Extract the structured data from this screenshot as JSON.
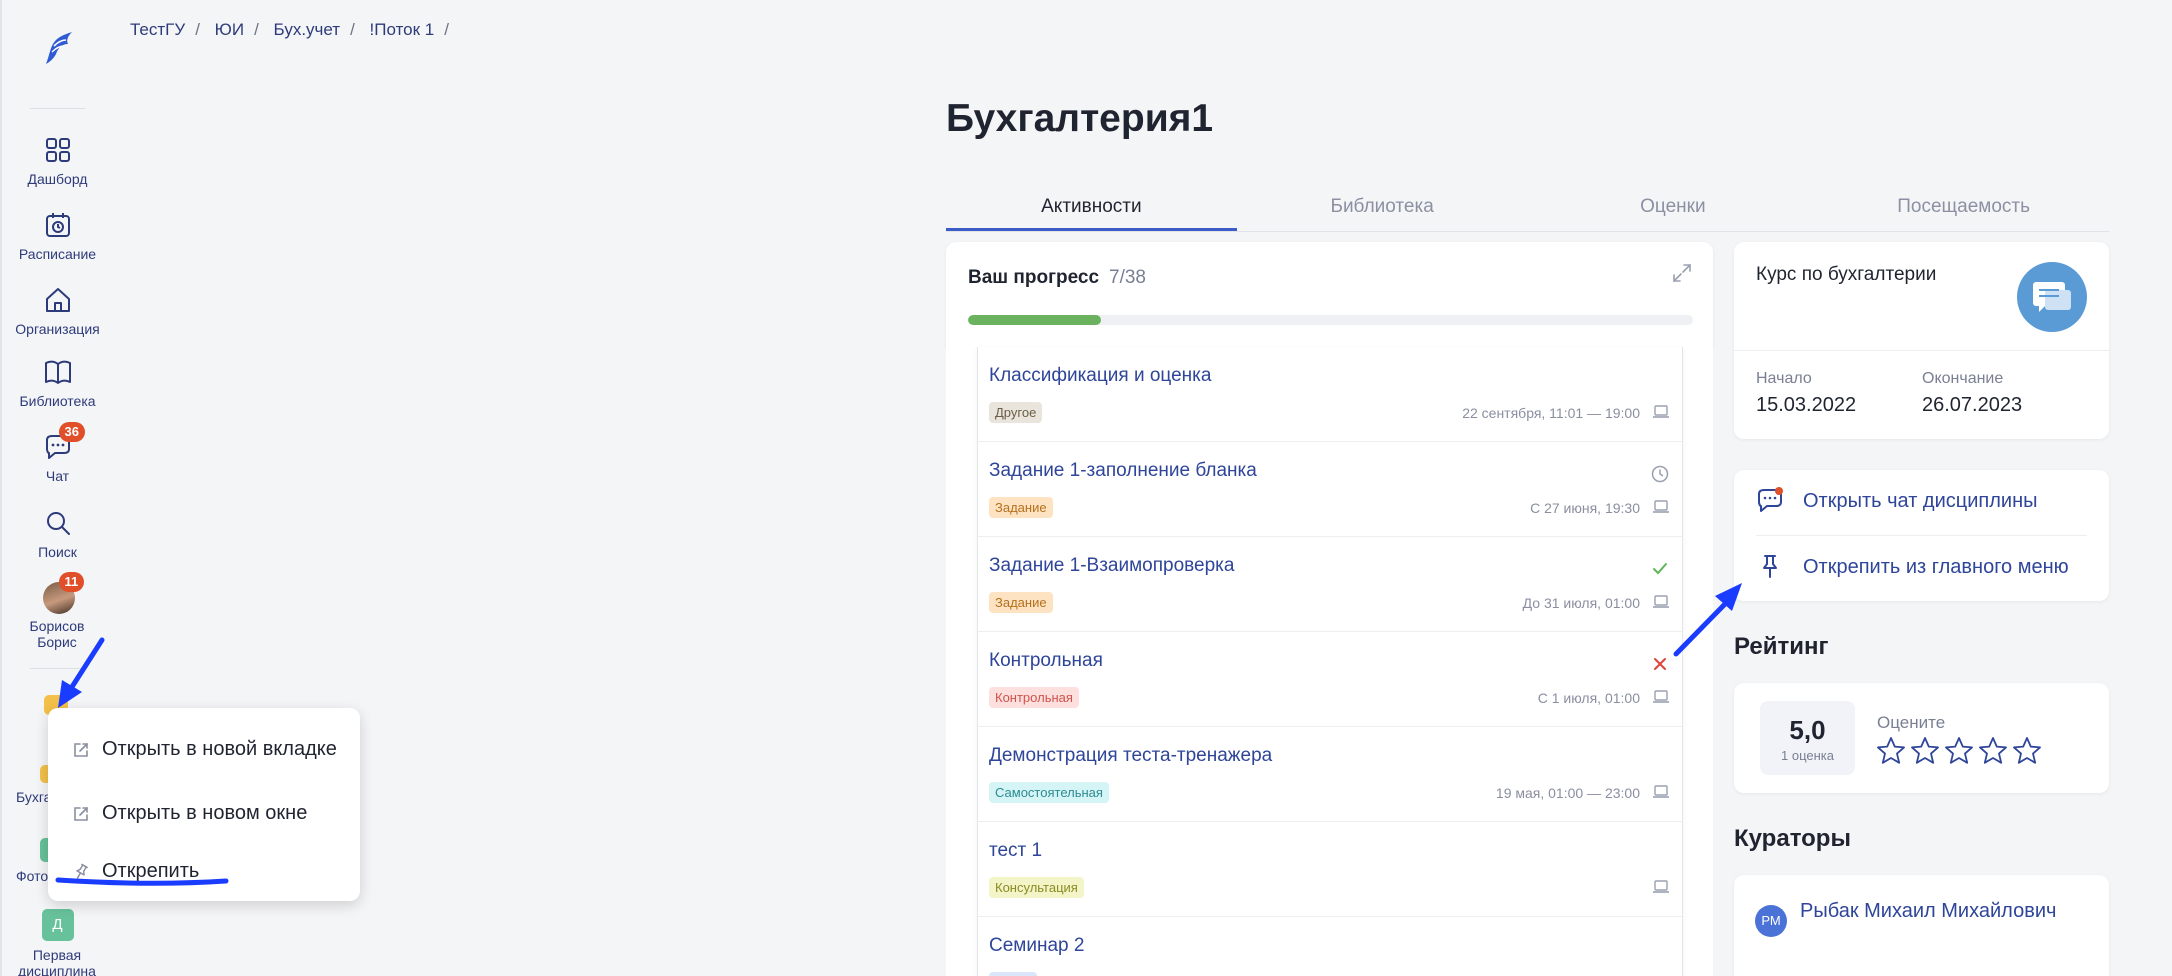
{
  "sidebar": {
    "items": [
      {
        "label": "Дашборд"
      },
      {
        "label": "Расписание"
      },
      {
        "label": "Организация"
      },
      {
        "label": "Библиотека"
      },
      {
        "label": "Чат",
        "badge": "36"
      },
      {
        "label": "Поиск"
      },
      {
        "label": "Борисов Борис",
        "badge": "11"
      }
    ],
    "pinned": [
      {
        "label": "Бухга",
        "color": "#f3c04a"
      },
      {
        "label": "Фото",
        "color": "#67c19a"
      },
      {
        "label": "Первая дисциплина",
        "letter": "Д",
        "color": "#67c19a"
      }
    ]
  },
  "breadcrumb": [
    "ТестГУ",
    "ЮИ",
    "Бух.учет",
    "!Поток 1"
  ],
  "page_title": "Бухгалтерия1",
  "tabs": [
    "Активности",
    "Библиотека",
    "Оценки",
    "Посещаемость"
  ],
  "progress": {
    "label": "Ваш прогресс",
    "count": "7/38",
    "fraction": 0.184
  },
  "activities": [
    {
      "title": "Классификация и оценка",
      "tag": "Другое",
      "tag_bg": "#e9e4dc",
      "tag_fg": "#6b5e49",
      "date": "22 сентября, 11:01 — 19:00",
      "status": ""
    },
    {
      "title": "Задание 1-заполнение бланка",
      "tag": "Задание",
      "tag_bg": "#fde3c2",
      "tag_fg": "#b5701c",
      "date": "С 27 июня, 19:30",
      "status": "clock"
    },
    {
      "title": "Задание 1-Взаимопроверка",
      "tag": "Задание",
      "tag_bg": "#fde3c2",
      "tag_fg": "#b5701c",
      "date": "До 31 июля, 01:00",
      "status": "check"
    },
    {
      "title": "Контрольная",
      "tag": "Контрольная",
      "tag_bg": "#fde0de",
      "tag_fg": "#d0534b",
      "date": "С 1 июля, 01:00",
      "status": "cross"
    },
    {
      "title": "Демонстрация теста-тренажера",
      "tag": "Самостоятельная",
      "tag_bg": "#d4f4f6",
      "tag_fg": "#2e8a93",
      "date": "19 мая, 01:00 — 23:00",
      "status": ""
    },
    {
      "title": "тест 1",
      "tag": "Консультация",
      "tag_bg": "#f3f5c8",
      "tag_fg": "#8a8b21",
      "date": "",
      "status": ""
    },
    {
      "title": "Семинар 2",
      "tag": "",
      "tag_bg": "#dbe6fb",
      "tag_fg": "#3a5fb0",
      "date": "",
      "status": ""
    }
  ],
  "course": {
    "name": "Курс по бухгалтерии",
    "start_label": "Начало",
    "start": "15.03.2022",
    "end_label": "Окончание",
    "end": "26.07.2023"
  },
  "actions": [
    "Открыть чат дисциплины",
    "Открепить из главного меню"
  ],
  "rating": {
    "heading": "Рейтинг",
    "score": "5,0",
    "count": "1 оценка",
    "prompt": "Оцените",
    "stars": 5
  },
  "curators": {
    "heading": "Кураторы",
    "items": [
      {
        "initials": "РМ",
        "name": "Рыбак Михаил Михайлович"
      }
    ]
  },
  "context_menu": [
    "Открыть в новой вкладке",
    "Открыть в новом окне",
    "Открепить"
  ],
  "colors": {
    "accent": "#3b5bc9",
    "link": "#2e4599",
    "annotation": "#1a3cff"
  }
}
